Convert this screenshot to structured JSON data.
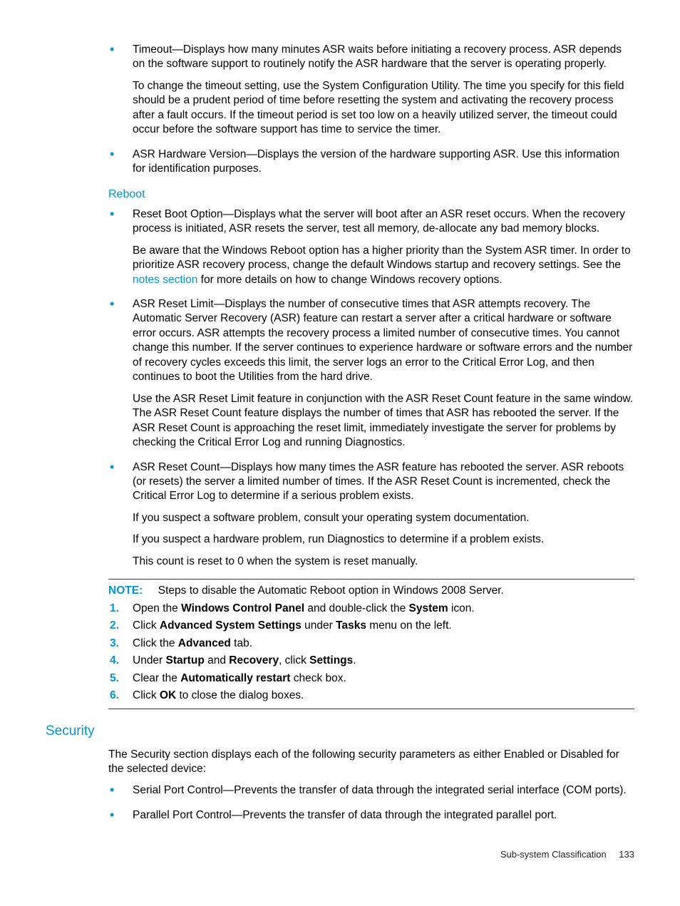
{
  "bullets_top": [
    {
      "p1": "Timeout—Displays how many minutes ASR waits before initiating a recovery process. ASR depends on the software support to routinely notify the ASR hardware that the server is operating properly.",
      "p2": "To change the timeout setting, use the System Configuration Utility. The time you specify for this field should be a prudent period of time before resetting the system and activating the recovery process after a fault occurs. If the timeout period is set too low on a heavily utilized server, the timeout could occur before the software support has time to service the timer."
    },
    {
      "p1": "ASR Hardware Version—Displays the version of the hardware supporting ASR. Use this information for identification purposes."
    }
  ],
  "reboot_heading": "Reboot",
  "reboot_bullets": [
    {
      "p1": "Reset Boot Option—Displays what the server will boot after an ASR reset occurs. When the recovery process is initiated, ASR resets the server, test all memory, de-allocate any bad memory blocks.",
      "p2a": "Be aware that the Windows Reboot option has a higher priority than the System ASR timer. In order to prioritize ASR recovery process, change the default Windows startup and recovery settings. See the ",
      "p2link": "notes section",
      "p2b": " for more details on how to change Windows recovery options."
    },
    {
      "p1": "ASR Reset Limit—Displays the number of consecutive times that ASR attempts recovery. The Automatic Server Recovery (ASR) feature can restart a server after a critical hardware or software error occurs. ASR attempts the recovery process a limited number of consecutive times. You cannot change this number. If the server continues to experience hardware or software errors and the number of recovery cycles exceeds this limit, the server logs an error to the Critical Error Log, and then continues to boot the Utilities from the hard drive.",
      "p2": "Use the ASR Reset Limit feature in conjunction with the ASR Reset Count feature in the same window. The ASR Reset Count feature displays the number of times that ASR has rebooted the server. If the ASR Reset Count is approaching the reset limit, immediately investigate the server for problems by checking the Critical Error Log and running Diagnostics."
    },
    {
      "p1": "ASR Reset Count—Displays how many times the ASR feature has rebooted the server. ASR reboots (or resets) the server a limited number of times. If the ASR Reset Count is incremented, check the Critical Error Log to determine if a serious problem exists.",
      "p2": "If you suspect a software problem, consult your operating system documentation.",
      "p3": "If you suspect a hardware problem, run Diagnostics to determine if a problem exists.",
      "p4": "This count is reset to 0 when the system is reset manually."
    }
  ],
  "note": {
    "label": "NOTE:",
    "text": "Steps to disable the Automatic Reboot option in Windows 2008 Server."
  },
  "steps": {
    "s1a": "Open the ",
    "s1b": "Windows Control Panel",
    "s1c": " and double-click the ",
    "s1d": "System",
    "s1e": " icon.",
    "s2a": "Click ",
    "s2b": "Advanced System Settings",
    "s2c": " under ",
    "s2d": "Tasks",
    "s2e": " menu on the left.",
    "s3a": "Click the ",
    "s3b": "Advanced",
    "s3c": " tab.",
    "s4a": "Under ",
    "s4b": "Startup",
    "s4c": " and ",
    "s4d": "Recovery",
    "s4e": ", click ",
    "s4f": "Settings",
    "s4g": ".",
    "s5a": "Clear the ",
    "s5b": "Automatically restart",
    "s5c": " check box.",
    "s6a": "Click ",
    "s6b": "OK",
    "s6c": " to close the dialog boxes."
  },
  "security": {
    "heading": "Security",
    "intro": "The Security section displays each of the following security parameters as either Enabled or Disabled for the selected device:",
    "bullets": [
      "Serial Port Control—Prevents the transfer of data through the integrated serial interface (COM ports).",
      "Parallel Port Control—Prevents the transfer of data through the integrated parallel port."
    ]
  },
  "footer": {
    "label": "Sub-system Classification",
    "page": "133"
  }
}
